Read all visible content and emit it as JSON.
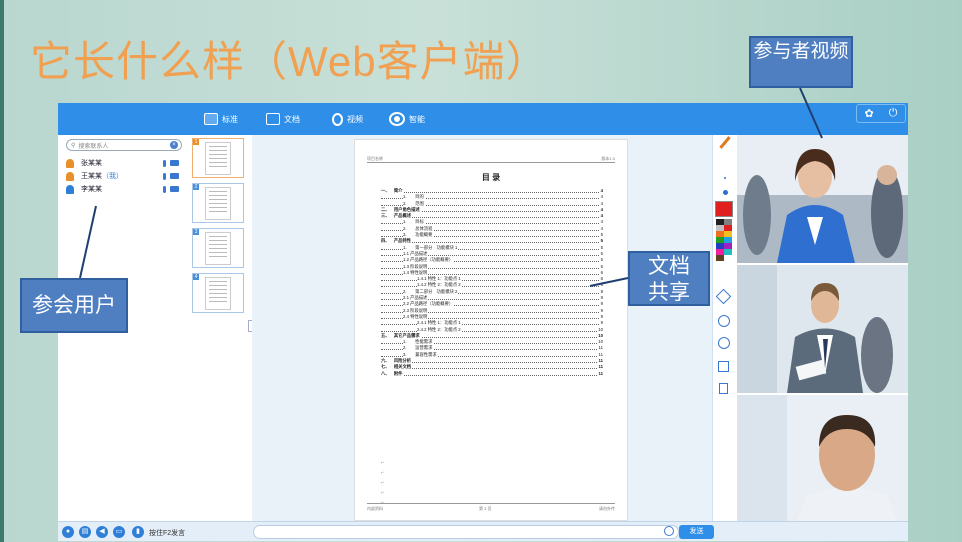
{
  "slide": {
    "title": "它长什么样（Web客户端）",
    "callouts": {
      "participant_video": "参与者视频",
      "doc_share": "文档共享",
      "attendees": "参会用户"
    }
  },
  "app": {
    "tabs": [
      {
        "label": "标准",
        "icon": "standard-layout-icon",
        "active": true
      },
      {
        "label": "文档",
        "icon": "document-icon",
        "active": false
      },
      {
        "label": "视频",
        "icon": "webcam-icon",
        "active": false
      },
      {
        "label": "智能",
        "icon": "smart-eye-icon",
        "active": false
      }
    ],
    "top_icons": [
      "gear-icon",
      "power-icon"
    ],
    "sidebar": {
      "search_placeholder": "搜索联系人",
      "users": [
        {
          "name": "张某某",
          "avatar_color": "#e8902c"
        },
        {
          "name": "王某某",
          "self_tag": "（我）",
          "avatar_color": "#e8902c"
        },
        {
          "name": "李某某",
          "avatar_color": "#2f7fd8"
        }
      ]
    },
    "thumbnails": [
      "1",
      "2",
      "3",
      "4"
    ],
    "document": {
      "header_left": "项目名称",
      "header_right": "版本1.0",
      "toc_title": "目 录",
      "toc": [
        {
          "level": 0,
          "num": "一、",
          "text": "简介",
          "page": "4"
        },
        {
          "level": 1,
          "num": "1.",
          "text": "目的",
          "page": "4"
        },
        {
          "level": 1,
          "num": "2.",
          "text": "范围",
          "page": "4"
        },
        {
          "level": 0,
          "num": "二、",
          "text": "用户角色描述",
          "page": "4"
        },
        {
          "level": 0,
          "num": "三、",
          "text": "产品概述",
          "page": "4"
        },
        {
          "level": 1,
          "num": "1.",
          "text": "目标",
          "page": "4"
        },
        {
          "level": 1,
          "num": "2.",
          "text": "总体流程",
          "page": "4"
        },
        {
          "level": 1,
          "num": "3.",
          "text": "功能概要",
          "page": "5"
        },
        {
          "level": 0,
          "num": "四、",
          "text": "产品特性",
          "page": "5"
        },
        {
          "level": 1,
          "num": "1.",
          "text": "第一部分　功能模块 1",
          "page": "5"
        },
        {
          "level": 2,
          "num": "",
          "text": "1.1 产品描述",
          "page": "5"
        },
        {
          "level": 2,
          "num": "",
          "text": "1.2 产品路径（功能概要）",
          "page": "5"
        },
        {
          "level": 2,
          "num": "",
          "text": "1.3 阶段说明",
          "page": "6"
        },
        {
          "level": 2,
          "num": "",
          "text": "1.4 特性说明",
          "page": "6"
        },
        {
          "level": 3,
          "num": "",
          "text": "1.4.1 特性 1：功能点 1",
          "page": "6"
        },
        {
          "level": 3,
          "num": "",
          "text": "1.4.2 特性 2：功能点 2",
          "page": "8"
        },
        {
          "level": 1,
          "num": "2.",
          "text": "第二部分　功能模块 2",
          "page": "8"
        },
        {
          "level": 2,
          "num": "",
          "text": "2.1 产品描述",
          "page": "9"
        },
        {
          "level": 2,
          "num": "",
          "text": "2.2 产品路径（功能概要）",
          "page": "9"
        },
        {
          "level": 2,
          "num": "",
          "text": "2.3 阶段说明",
          "page": "9"
        },
        {
          "level": 2,
          "num": "",
          "text": "2.4 特性说明",
          "page": "9"
        },
        {
          "level": 3,
          "num": "",
          "text": "2.4.1 特性 1：功能点 1",
          "page": "9"
        },
        {
          "level": 3,
          "num": "",
          "text": "2.4.2 特性 2：功能点 2",
          "page": "10"
        },
        {
          "level": 0,
          "num": "五、",
          "text": "其它产品需求",
          "page": "10"
        },
        {
          "level": 1,
          "num": "1.",
          "text": "性能需求",
          "page": "10"
        },
        {
          "level": 1,
          "num": "2.",
          "text": "运营需求",
          "page": "11"
        },
        {
          "level": 1,
          "num": "3.",
          "text": "兼容性需求",
          "page": "11"
        },
        {
          "level": 0,
          "num": "六、",
          "text": "风险分析",
          "page": "11"
        },
        {
          "level": 0,
          "num": "七、",
          "text": "相关文档",
          "page": "11"
        },
        {
          "level": 0,
          "num": "八、",
          "text": "附件",
          "page": "11"
        }
      ],
      "footer_left": "内部资料",
      "footer_center": "第 3 页",
      "footer_right": "请勿外传"
    },
    "palette": [
      "#202020",
      "#808080",
      "#c0c0c0",
      "#e02020",
      "#f07020",
      "#f0c020",
      "#20a020",
      "#20a0e0",
      "#2040c0",
      "#a020c0",
      "#f020a0",
      "#20c0c0",
      "#604020",
      "#ffffff"
    ],
    "tool_icons": [
      "pen-icon",
      "eraser-icon",
      "zoom-out-icon",
      "zoom-in-icon",
      "fit-screen-icon",
      "doc-info-icon"
    ],
    "bottom": {
      "icons": [
        "person-icon",
        "contacts-icon",
        "speaker-icon",
        "chat-icon",
        "mic-icon"
      ],
      "hint": "按住F2发言",
      "send_label": "发送"
    }
  }
}
